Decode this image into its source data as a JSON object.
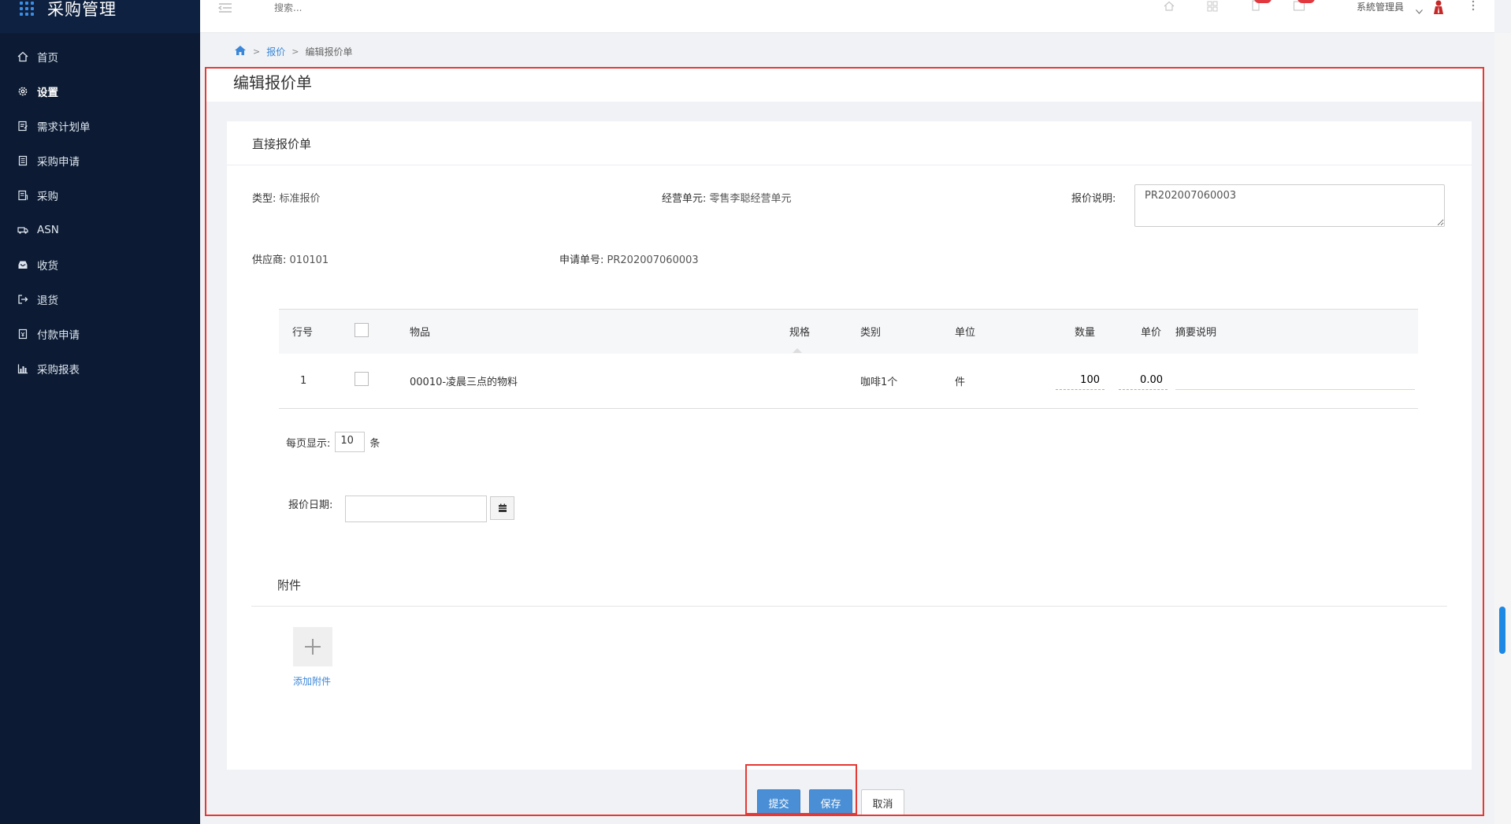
{
  "app": {
    "title": "采购管理"
  },
  "header": {
    "search_placeholder": "搜索...",
    "user_name": "系統管理員"
  },
  "sidebar": {
    "items": [
      {
        "label": "首页",
        "icon": "home-icon"
      },
      {
        "label": "设置",
        "icon": "gear-icon"
      },
      {
        "label": "需求计划单",
        "icon": "edit-doc-icon"
      },
      {
        "label": "采购申请",
        "icon": "list-doc-icon"
      },
      {
        "label": "采购",
        "icon": "order-doc-icon"
      },
      {
        "label": "ASN",
        "icon": "truck-icon"
      },
      {
        "label": "收货",
        "icon": "inbox-icon"
      },
      {
        "label": "退货",
        "icon": "return-icon"
      },
      {
        "label": "付款申请",
        "icon": "payment-doc-icon"
      },
      {
        "label": "采购报表",
        "icon": "bar-chart-icon"
      }
    ]
  },
  "breadcrumb": {
    "level1": "报价",
    "current": "编辑报价单",
    "sep": ">"
  },
  "page": {
    "title": "编辑报价单"
  },
  "form": {
    "card_title": "直接报价单",
    "type_label": "类型:",
    "type_value": "标准报价",
    "unit_label": "经营单元:",
    "unit_value": "零售李聪经营单元",
    "remark_label": "报价说明:",
    "remark_value": "PR202007060003",
    "supplier_label": "供应商:",
    "supplier_value": "010101",
    "req_label": "申请单号:",
    "req_value": "PR202007060003"
  },
  "table": {
    "headers": {
      "row_no": "行号",
      "item": "物品",
      "spec": "规格",
      "category": "类别",
      "unit": "单位",
      "qty": "数量",
      "price": "单价",
      "summary": "摘要说明"
    },
    "rows": [
      {
        "row_no": "1",
        "item": "00010-凌晨三点的物料",
        "spec": "",
        "category": "咖啡1个",
        "unit": "件",
        "qty": "100",
        "price": "0.00",
        "summary": ""
      }
    ]
  },
  "pagination": {
    "label": "每页显示:",
    "size": "10",
    "suffix": "条"
  },
  "date": {
    "label": "报价日期:",
    "value": ""
  },
  "attachments": {
    "title": "附件",
    "add_label": "添加附件"
  },
  "actions": {
    "submit": "提交",
    "save": "保存",
    "cancel": "取消"
  }
}
